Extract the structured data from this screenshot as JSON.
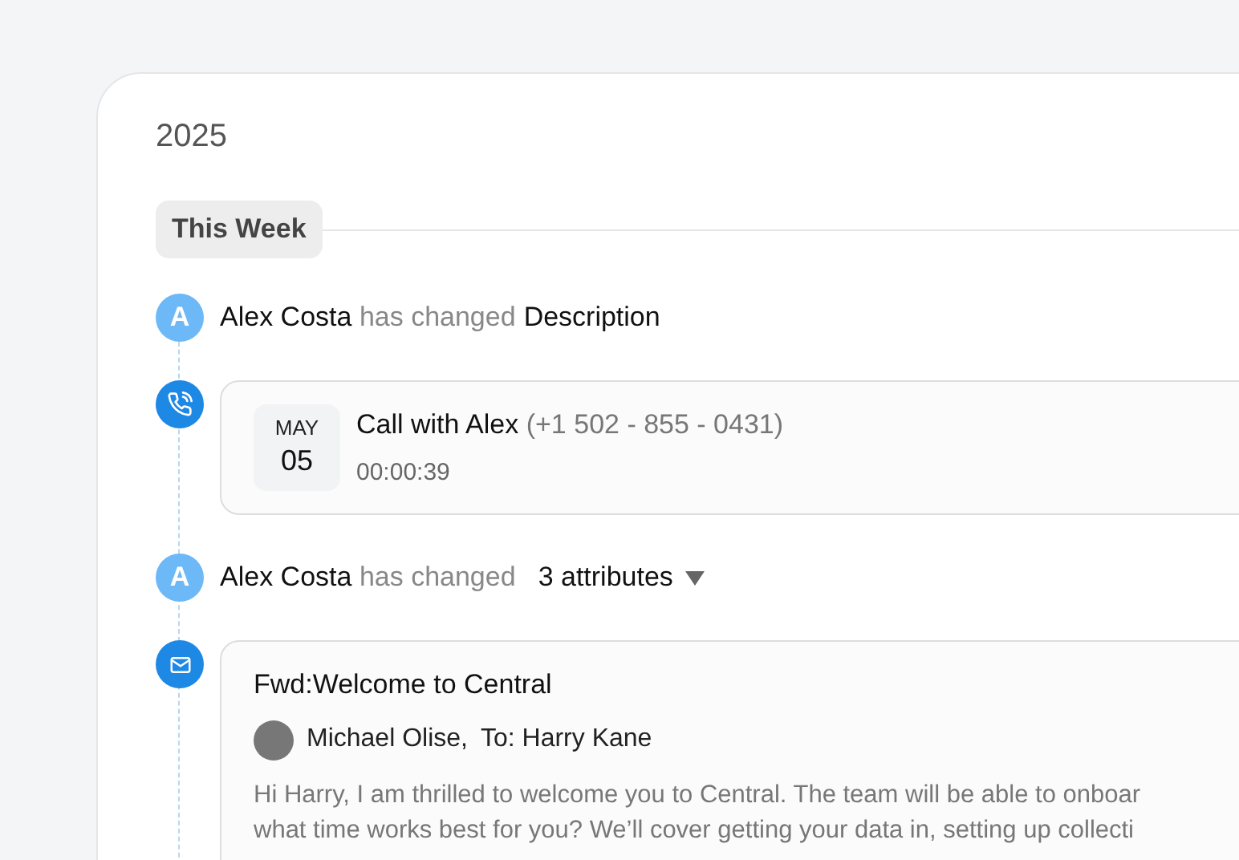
{
  "year": "2025",
  "section": {
    "label": "This Week"
  },
  "events": [
    {
      "kind": "change",
      "avatar": "A",
      "actor": "Alex Costa",
      "verb": "has changed",
      "object": "Description",
      "expandable": false
    },
    {
      "kind": "call",
      "month": "MAY",
      "day": "05",
      "title": "Call with Alex",
      "phone": "(+1 502 - 855 - 0431)",
      "duration": "00:00:39"
    },
    {
      "kind": "change",
      "avatar": "A",
      "actor": "Alex Costa",
      "verb": "has changed",
      "object": "3 attributes",
      "expandable": true
    },
    {
      "kind": "email",
      "subject": "Fwd:Welcome to Central",
      "from": "Michael Olise,",
      "to": "To: Harry Kane",
      "body": [
        "Hi Harry, I am thrilled to welcome you to Central. The team will be able to onboar",
        "what time works best for you? We’ll cover getting your data in, setting up collecti"
      ]
    }
  ]
}
